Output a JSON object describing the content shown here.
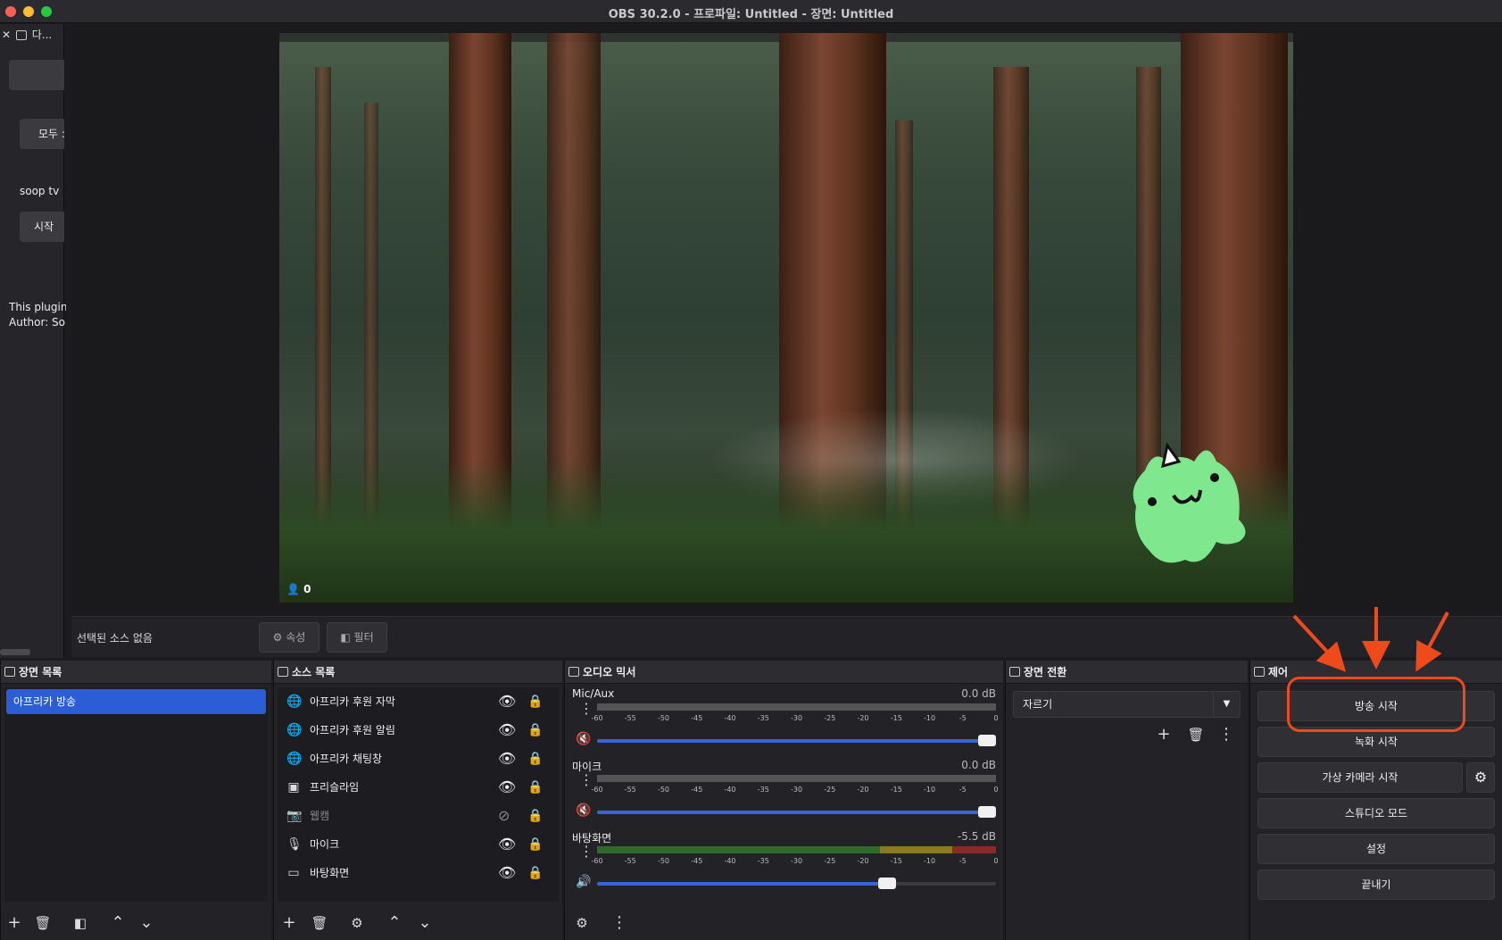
{
  "window": {
    "title": "OBS 30.2.0 - 프로파일: Untitled - 장면: Untitled"
  },
  "left_dock": {
    "header": "다...",
    "all_button": "모두 :",
    "service_label": "soop tv",
    "start_button": "시작",
    "plugin_text_line1": "This plugin",
    "plugin_text_line2": "Author: Sor"
  },
  "preview": {
    "viewer_count": "0"
  },
  "status": {
    "no_source_label": "선택된 소스 없음",
    "properties_button": "속성",
    "filters_button": "필터"
  },
  "scenes": {
    "title": "장면 목록",
    "items": [
      {
        "label": "아프리카 방송",
        "selected": true
      }
    ]
  },
  "sources": {
    "title": "소스 목록",
    "items": [
      {
        "label": "아프리카 후원 자막",
        "icon": "globe-icon",
        "visible": true
      },
      {
        "label": "아프리카 후원 알림",
        "icon": "globe-icon",
        "visible": true
      },
      {
        "label": "아프리카 채팅창",
        "icon": "globe-icon",
        "visible": true
      },
      {
        "label": "프리슬라임",
        "icon": "image-icon",
        "visible": true
      },
      {
        "label": "웹캠",
        "icon": "camera-icon",
        "visible": false
      },
      {
        "label": "마이크",
        "icon": "microphone-icon",
        "visible": true
      },
      {
        "label": "바탕화면",
        "icon": "monitor-icon",
        "visible": true
      }
    ]
  },
  "mixer": {
    "title": "오디오 믹서",
    "ticks": [
      "-60",
      "-55",
      "-50",
      "-45",
      "-40",
      "-35",
      "-30",
      "-25",
      "-20",
      "-15",
      "-10",
      "-5",
      "0"
    ],
    "channels": [
      {
        "name": "Mic/Aux",
        "db": "0.0 dB",
        "muted": true,
        "volume": 1.0,
        "level": 0.0
      },
      {
        "name": "마이크",
        "db": "0.0 dB",
        "muted": true,
        "volume": 1.0,
        "level": 0.0
      },
      {
        "name": "바탕화면",
        "db": "-5.5 dB",
        "muted": false,
        "volume": 0.75,
        "level": 1.0
      }
    ]
  },
  "transitions": {
    "title": "장면 전환",
    "selected": "자르기"
  },
  "controls": {
    "title": "제어",
    "start_streaming": "방송 시작",
    "start_recording": "녹화 시작",
    "start_virtual_camera": "가상 카메라 시작",
    "studio_mode": "스튜디오 모드",
    "settings": "설정",
    "exit": "끝내기"
  },
  "colors": {
    "accent": "#2a5dd6",
    "annotation": "#ee4a1a"
  }
}
